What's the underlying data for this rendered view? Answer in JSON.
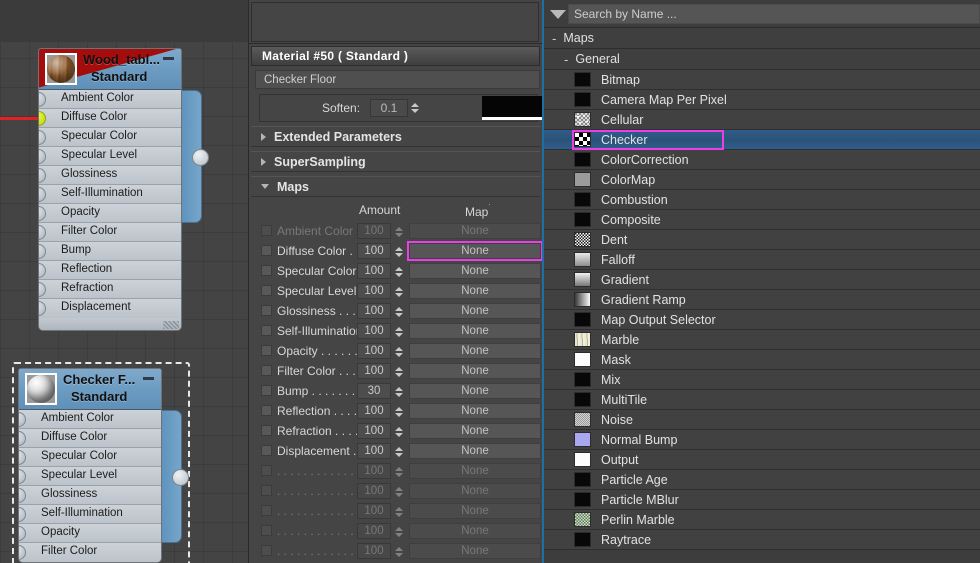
{
  "canvas": {
    "nodes": [
      {
        "title": "Wood_tabl...",
        "subtitle": "Standard",
        "thumb": "wood-sphere-thumb",
        "active": true,
        "slots": [
          "Ambient Color",
          "Diffuse Color",
          "Specular Color",
          "Specular Level",
          "Glossiness",
          "Self-Illumination",
          "Opacity",
          "Filter Color",
          "Bump",
          "Reflection",
          "Refraction",
          "Displacement"
        ],
        "lit_slot": "Diffuse Color"
      },
      {
        "title": "Checker F...",
        "subtitle": "Standard",
        "thumb": "gray-sphere-thumb",
        "active": false,
        "slots": [
          "Ambient Color",
          "Diffuse Color",
          "Specular Color",
          "Specular Level",
          "Glossiness",
          "Self-Illumination",
          "Opacity",
          "Filter Color"
        ],
        "lit_slot": ""
      }
    ],
    "wire_color": "#e22121",
    "selection_color": "#e8e8e8"
  },
  "material_panel": {
    "title": "Material #50  ( Standard )",
    "name_field": "Checker Floor",
    "soften_label": "Soften:",
    "soften_value": "0.1",
    "rollups": [
      {
        "label": "Extended Parameters",
        "expanded": false
      },
      {
        "label": "SuperSampling",
        "expanded": false
      },
      {
        "label": "Maps",
        "expanded": true
      }
    ],
    "columns": {
      "amount": "Amount",
      "map": "Map"
    },
    "map_rows": [
      {
        "name": "Ambient Color . . .",
        "amount": "100",
        "map": "None",
        "enabled": false,
        "highlighted": false
      },
      {
        "name": "Diffuse Color . . . .",
        "amount": "100",
        "map": "None",
        "enabled": true,
        "highlighted": true
      },
      {
        "name": "Specular Color  . .",
        "amount": "100",
        "map": "None",
        "enabled": true,
        "highlighted": false
      },
      {
        "name": "Specular Level . .",
        "amount": "100",
        "map": "None",
        "enabled": true,
        "highlighted": false
      },
      {
        "name": "Glossiness . . . . .",
        "amount": "100",
        "map": "None",
        "enabled": true,
        "highlighted": false
      },
      {
        "name": "Self-Illumination . .",
        "amount": "100",
        "map": "None",
        "enabled": true,
        "highlighted": false
      },
      {
        "name": "Opacity . . . . . . .",
        "amount": "100",
        "map": "None",
        "enabled": true,
        "highlighted": false
      },
      {
        "name": "Filter Color  . . . . .",
        "amount": "100",
        "map": "None",
        "enabled": true,
        "highlighted": false
      },
      {
        "name": "Bump . . . . . . . . .",
        "amount": "30",
        "map": "None",
        "enabled": true,
        "highlighted": false
      },
      {
        "name": "Reflection . . . . .",
        "amount": "100",
        "map": "None",
        "enabled": true,
        "highlighted": false
      },
      {
        "name": "Refraction . . . . .",
        "amount": "100",
        "map": "None",
        "enabled": true,
        "highlighted": false
      },
      {
        "name": "Displacement . . .",
        "amount": "100",
        "map": "None",
        "enabled": true,
        "highlighted": false
      },
      {
        "name": ". . . . . . . . . . . . .",
        "amount": "100",
        "map": "None",
        "enabled": false,
        "highlighted": false
      },
      {
        "name": ". . . . . . . . . . . . .",
        "amount": "100",
        "map": "None",
        "enabled": false,
        "highlighted": false
      },
      {
        "name": ". . . . . . . . . . . . .",
        "amount": "100",
        "map": "None",
        "enabled": false,
        "highlighted": false
      },
      {
        "name": ". . . . . . . . . . . . .",
        "amount": "100",
        "map": "None",
        "enabled": false,
        "highlighted": false
      },
      {
        "name": ". . . . . . . . . . . . .",
        "amount": "100",
        "map": "None",
        "enabled": false,
        "highlighted": false
      }
    ],
    "highlight_color": "#e83fe8"
  },
  "browser": {
    "search_placeholder": "Search by Name ...",
    "groups": [
      {
        "label": "Maps",
        "level": 1,
        "expanded": true
      },
      {
        "label": "General",
        "level": 2,
        "expanded": true
      }
    ],
    "selected_item": "Checker",
    "selection_color": "#2e5d8c",
    "highlight_color": "#e83fe8",
    "items": [
      {
        "label": "Bitmap",
        "icon": "black-swatch-icon"
      },
      {
        "label": "Camera Map Per Pixel",
        "icon": "black-swatch-icon"
      },
      {
        "label": "Cellular",
        "icon": "cellular-swatch-icon"
      },
      {
        "label": "Checker",
        "icon": "checker-swatch-icon"
      },
      {
        "label": "ColorCorrection",
        "icon": "black-swatch-icon"
      },
      {
        "label": "ColorMap",
        "icon": "gray-swatch-icon"
      },
      {
        "label": "Combustion",
        "icon": "black-swatch-icon"
      },
      {
        "label": "Composite",
        "icon": "black-swatch-icon"
      },
      {
        "label": "Dent",
        "icon": "dent-swatch-icon"
      },
      {
        "label": "Falloff",
        "icon": "falloff-swatch-icon"
      },
      {
        "label": "Gradient",
        "icon": "gradient-swatch-icon"
      },
      {
        "label": "Gradient Ramp",
        "icon": "gradient-ramp-swatch-icon"
      },
      {
        "label": "Map Output Selector",
        "icon": "black-swatch-icon"
      },
      {
        "label": "Marble",
        "icon": "marble-swatch-icon"
      },
      {
        "label": "Mask",
        "icon": "white-swatch-icon"
      },
      {
        "label": "Mix",
        "icon": "black-swatch-icon"
      },
      {
        "label": "MultiTile",
        "icon": "black-swatch-icon"
      },
      {
        "label": "Noise",
        "icon": "noise-swatch-icon"
      },
      {
        "label": "Normal Bump",
        "icon": "normal-bump-swatch-icon"
      },
      {
        "label": "Output",
        "icon": "white-swatch-icon"
      },
      {
        "label": "Particle Age",
        "icon": "black-swatch-icon"
      },
      {
        "label": "Particle MBlur",
        "icon": "black-swatch-icon"
      },
      {
        "label": "Perlin Marble",
        "icon": "perlin-marble-swatch-icon"
      },
      {
        "label": "Raytrace",
        "icon": "black-swatch-icon"
      }
    ]
  }
}
